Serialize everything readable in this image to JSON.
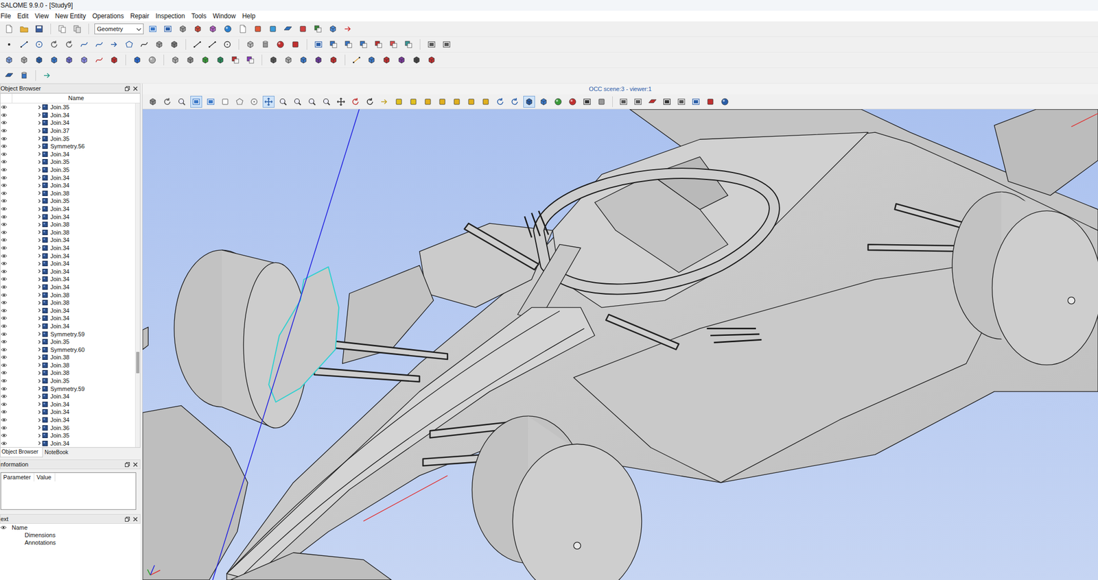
{
  "window": {
    "title": "SALOME 9.9.0 - [Study9]"
  },
  "menu": [
    "File",
    "Edit",
    "View",
    "New Entity",
    "Operations",
    "Repair",
    "Inspection",
    "Tools",
    "Window",
    "Help"
  ],
  "toolbar": {
    "module": "Geometry"
  },
  "object_browser": {
    "title": "Object Browser",
    "column": "Name",
    "scroll_position": 0.77,
    "items": [
      {
        "name": "Join.35",
        "visible": true,
        "expanded": false,
        "selected": false
      },
      {
        "name": "Join.34",
        "visible": true,
        "expanded": false,
        "selected": false
      },
      {
        "name": "Join.34",
        "visible": true,
        "expanded": false,
        "selected": false
      },
      {
        "name": "Join.37",
        "visible": true,
        "expanded": false,
        "selected": false
      },
      {
        "name": "Join.35",
        "visible": true,
        "expanded": false,
        "selected": false
      },
      {
        "name": "Symmetry.56",
        "visible": true,
        "expanded": false,
        "selected": false
      },
      {
        "name": "Join.34",
        "visible": true,
        "expanded": false,
        "selected": false
      },
      {
        "name": "Join.35",
        "visible": true,
        "expanded": false,
        "selected": false
      },
      {
        "name": "Join.35",
        "visible": true,
        "expanded": false,
        "selected": false
      },
      {
        "name": "Join.34",
        "visible": true,
        "expanded": false,
        "selected": false
      },
      {
        "name": "Join.34",
        "visible": true,
        "expanded": false,
        "selected": false
      },
      {
        "name": "Join.38",
        "visible": true,
        "expanded": false,
        "selected": false
      },
      {
        "name": "Join.35",
        "visible": true,
        "expanded": false,
        "selected": false
      },
      {
        "name": "Join.34",
        "visible": true,
        "expanded": false,
        "selected": false
      },
      {
        "name": "Join.34",
        "visible": true,
        "expanded": false,
        "selected": false
      },
      {
        "name": "Join.38",
        "visible": true,
        "expanded": false,
        "selected": false
      },
      {
        "name": "Join.38",
        "visible": true,
        "expanded": false,
        "selected": false
      },
      {
        "name": "Join.34",
        "visible": true,
        "expanded": false,
        "selected": false
      },
      {
        "name": "Join.34",
        "visible": true,
        "expanded": false,
        "selected": false
      },
      {
        "name": "Join.34",
        "visible": true,
        "expanded": false,
        "selected": false
      },
      {
        "name": "Join.34",
        "visible": true,
        "expanded": false,
        "selected": false
      },
      {
        "name": "Join.34",
        "visible": true,
        "expanded": false,
        "selected": false
      },
      {
        "name": "Join.34",
        "visible": true,
        "expanded": false,
        "selected": false
      },
      {
        "name": "Join.34",
        "visible": true,
        "expanded": false,
        "selected": false
      },
      {
        "name": "Join.38",
        "visible": true,
        "expanded": false,
        "selected": false
      },
      {
        "name": "Join.38",
        "visible": true,
        "expanded": false,
        "selected": false
      },
      {
        "name": "Join.34",
        "visible": true,
        "expanded": false,
        "selected": false
      },
      {
        "name": "Join.34",
        "visible": true,
        "expanded": false,
        "selected": false
      },
      {
        "name": "Join.34",
        "visible": true,
        "expanded": false,
        "selected": false
      },
      {
        "name": "Symmetry.59",
        "visible": true,
        "expanded": false,
        "selected": false
      },
      {
        "name": "Join.35",
        "visible": true,
        "expanded": false,
        "selected": false
      },
      {
        "name": "Symmetry.60",
        "visible": true,
        "expanded": false,
        "selected": false
      },
      {
        "name": "Join.38",
        "visible": true,
        "expanded": false,
        "selected": false
      },
      {
        "name": "Join.38",
        "visible": true,
        "expanded": false,
        "selected": false
      },
      {
        "name": "Join.38",
        "visible": true,
        "expanded": false,
        "selected": false
      },
      {
        "name": "Join.35",
        "visible": true,
        "expanded": false,
        "selected": false
      },
      {
        "name": "Symmetry.59",
        "visible": true,
        "expanded": false,
        "selected": false
      },
      {
        "name": "Join.34",
        "visible": true,
        "expanded": false,
        "selected": false
      },
      {
        "name": "Join.34",
        "visible": true,
        "expanded": false,
        "selected": false
      },
      {
        "name": "Join.34",
        "visible": true,
        "expanded": false,
        "selected": false
      },
      {
        "name": "Join.34",
        "visible": true,
        "expanded": false,
        "selected": false
      },
      {
        "name": "Join.36",
        "visible": true,
        "expanded": false,
        "selected": false
      },
      {
        "name": "Join.35",
        "visible": true,
        "expanded": false,
        "selected": false
      },
      {
        "name": "Join.34",
        "visible": true,
        "expanded": false,
        "selected": false
      }
    ]
  },
  "dock_tabs": [
    {
      "label": "Object Browser",
      "selected": true
    },
    {
      "label": "NoteBook",
      "selected": false
    }
  ],
  "information": {
    "title": "nformation",
    "columns": [
      "Parameter",
      "Value"
    ]
  },
  "text_panel": {
    "title": "ext",
    "column": "Name",
    "items": [
      "Dimensions",
      "Annotations"
    ]
  },
  "viewer": {
    "title": "OCC scene:3 - viewer:1"
  }
}
